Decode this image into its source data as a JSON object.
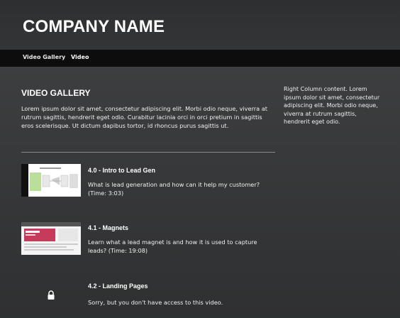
{
  "header": {
    "brand": "COMPANY NAME"
  },
  "nav": {
    "items": [
      "Video Gallery",
      "Video"
    ]
  },
  "gallery": {
    "title": "VIDEO GALLERY",
    "description": "Lorem ipsum dolor sit amet, consectetur adipiscing elit. Morbi odio neque, viverra at rutrum sagittis, hendrerit eget odio. Curabitur lacinia orci in orci pretium in sagittis eros scelerisque. Ut dictum dapibus tortor, id rhoncus purus sagittis ut."
  },
  "right_column": {
    "text": "Right Column content.  Lorem ipsum dolor sit amet, consectetur adipiscing elit. Morbi odio neque, viverra at rutrum sagittis, hendrerit eget odio."
  },
  "videos": [
    {
      "title": "4.0 - Intro to Lead Gen",
      "description": "What is lead generation and how can it help my customer? (Time: 3:03)",
      "thumbnail": "diagram-thumbnail"
    },
    {
      "title": "4.1 - Magnets",
      "description": "Learn what a lead magnet is and how it is used to capture leads? (Time: 19:08)",
      "thumbnail": "webpage-thumbnail"
    },
    {
      "title": "4.2 - Landing Pages",
      "description": "Sorry, but you don't have access to this video.",
      "thumbnail": "lock-icon"
    }
  ]
}
